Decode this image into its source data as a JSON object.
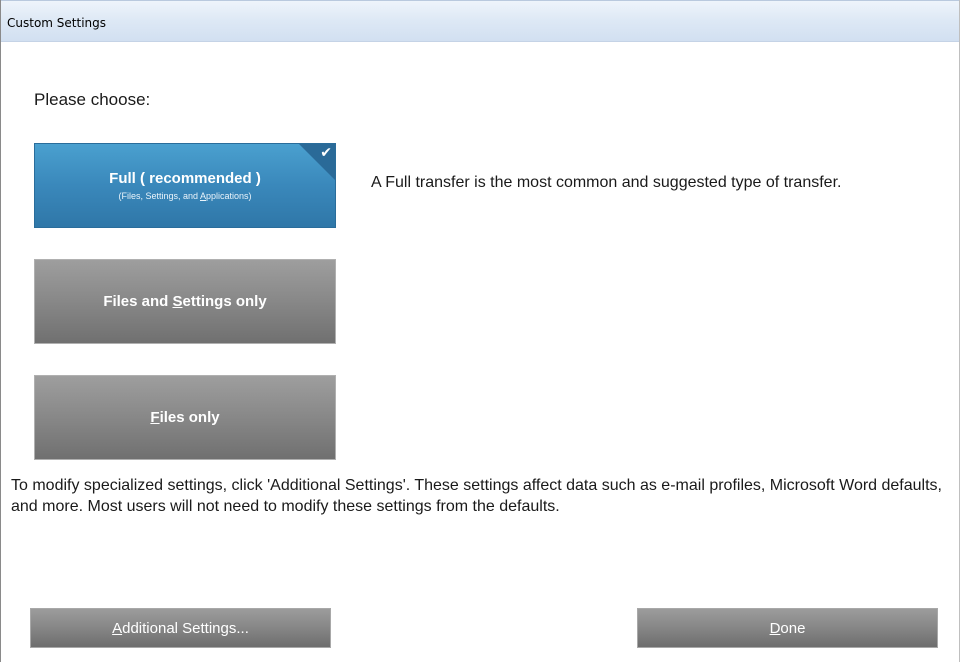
{
  "window": {
    "title": "Custom Settings"
  },
  "prompt": "Please choose:",
  "options": [
    {
      "label": "Full ( recommended )",
      "sublabel_pre": "(Files, Settings, and ",
      "sublabel_accel": "A",
      "sublabel_post": "pplications)",
      "selected": true,
      "check_icon": "checkmark-icon"
    },
    {
      "label_pre": "Files and ",
      "label_accel": "S",
      "label_post": "ettings only",
      "selected": false
    },
    {
      "label_pre": "",
      "label_accel": "F",
      "label_post": "iles only",
      "selected": false
    }
  ],
  "description": "A Full transfer is the most common and suggested type of transfer.",
  "info_text": "To modify specialized settings, click 'Additional Settings'. These settings affect data such as e-mail profiles, Microsoft Word defaults, and more. Most users will not need to modify these settings from the defaults.",
  "buttons": {
    "additional": {
      "accel": "A",
      "rest": "dditional Settings..."
    },
    "done": {
      "accel": "D",
      "rest": "one"
    }
  },
  "colors": {
    "selected_option": "#3a88bb",
    "option": "#8a8a8a",
    "titlebar": "#dde8f5"
  }
}
